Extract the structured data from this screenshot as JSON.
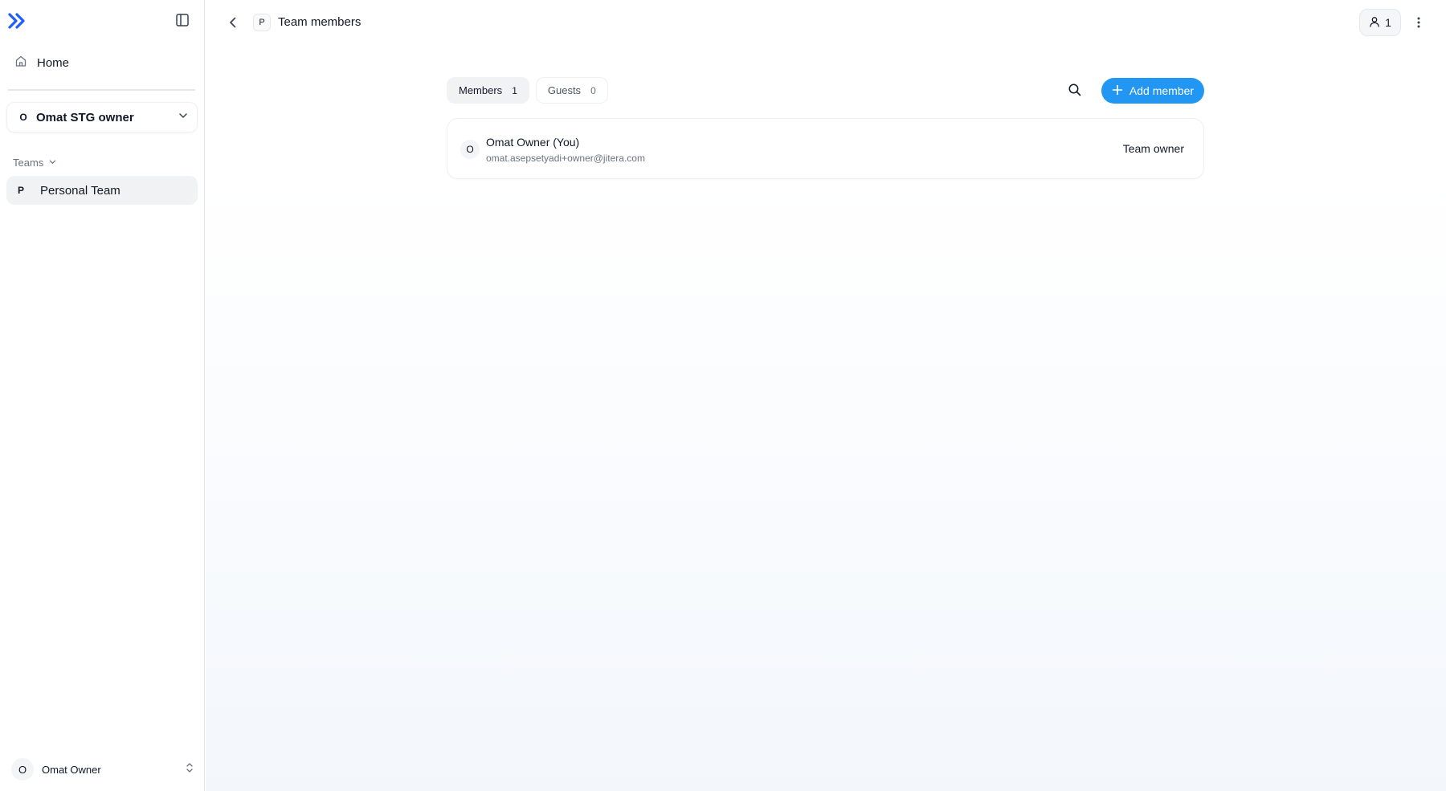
{
  "sidebar": {
    "home_label": "Home",
    "org": {
      "initial": "O",
      "name": "Omat STG owner"
    },
    "teams_label": "Teams",
    "teams": [
      {
        "initial": "P",
        "name": "Personal Team"
      }
    ],
    "user": {
      "initial": "O",
      "name": "Omat Owner"
    }
  },
  "header": {
    "team_initial": "P",
    "title": "Team members",
    "member_count": "1"
  },
  "tabs": [
    {
      "label": "Members",
      "count": "1",
      "active": true
    },
    {
      "label": "Guests",
      "count": "0",
      "active": false
    }
  ],
  "actions": {
    "add_member_label": "Add member"
  },
  "members": [
    {
      "initial": "O",
      "name": "Omat Owner (You)",
      "email": "omat.asepsetyadi+owner@jitera.com",
      "role": "Team owner"
    }
  ],
  "colors": {
    "accent": "#2196f3",
    "logo": "#1e5eff"
  },
  "icons": [
    "logo-icon",
    "sidebar-toggle-icon",
    "home-icon",
    "chevron-down-icon",
    "chevron-left-icon",
    "user-icon",
    "more-vertical-icon",
    "search-icon",
    "plus-icon",
    "chevron-up-down-icon"
  ]
}
